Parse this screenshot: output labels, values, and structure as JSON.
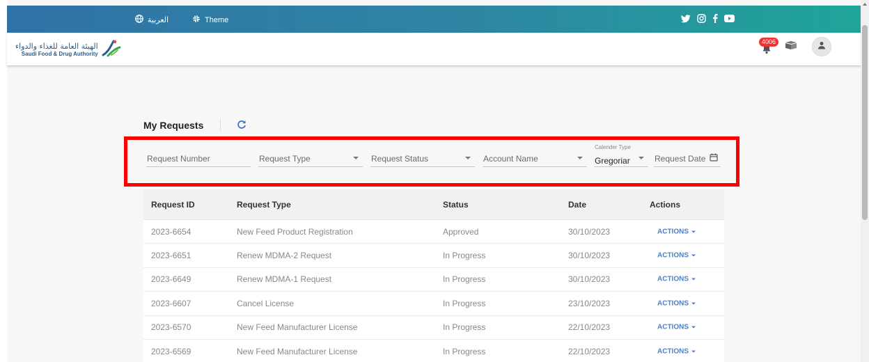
{
  "topbar": {
    "language_label": "العربية",
    "theme_label": "Theme",
    "social_icons": [
      "twitter-icon",
      "instagram-icon",
      "facebook-icon",
      "youtube-icon"
    ]
  },
  "header": {
    "logo_ar": "الهيئة العامة للغذاء والدواء",
    "logo_en": "Saudi Food & Drug Authority",
    "notification_count": "4006"
  },
  "page": {
    "title": "My Requests"
  },
  "filters": {
    "request_number": "Request Number",
    "request_type": "Request Type",
    "request_status": "Request Status",
    "account_name": "Account Name",
    "calendar_type_label": "Calender Type",
    "calendar_type_value": "Gregoriar",
    "request_date": "Request Date"
  },
  "table": {
    "headers": {
      "id": "Request ID",
      "type": "Request Type",
      "status": "Status",
      "date": "Date",
      "actions": "Actions"
    },
    "rows": [
      {
        "id": "2023-6654",
        "type": "New Feed Product Registration",
        "status": "Approved",
        "date": "30/10/2023",
        "action": "ACTIONS"
      },
      {
        "id": "2023-6651",
        "type": "Renew MDMA-2 Request",
        "status": "In Progress",
        "date": "30/10/2023",
        "action": "ACTIONS"
      },
      {
        "id": "2023-6649",
        "type": "Renew MDMA-1 Request",
        "status": "In Progress",
        "date": "30/10/2023",
        "action": "ACTIONS"
      },
      {
        "id": "2023-6607",
        "type": "Cancel License",
        "status": "In Progress",
        "date": "23/10/2023",
        "action": "ACTIONS"
      },
      {
        "id": "2023-6570",
        "type": "New Feed Manufacturer License",
        "status": "In Progress",
        "date": "22/10/2023",
        "action": "ACTIONS"
      },
      {
        "id": "2023-6569",
        "type": "New Feed Manufacturer License",
        "status": "In Progress",
        "date": "22/10/2023",
        "action": "ACTIONS"
      }
    ]
  },
  "colors": {
    "topbar_start": "#2f73a7",
    "topbar_end": "#1fa59a",
    "highlight": "#ff0000",
    "action_link": "#4b7fc8",
    "badge": "#e33333"
  }
}
